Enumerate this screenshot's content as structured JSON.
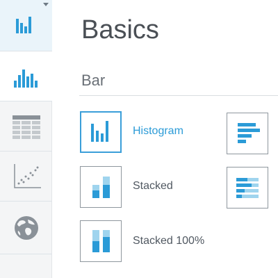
{
  "header": {
    "title": "Basics"
  },
  "section": {
    "title": "Bar"
  },
  "rail": {
    "top_icon": "bar-chart-icon",
    "items": [
      {
        "icon": "histogram-icon"
      },
      {
        "icon": "table-icon"
      },
      {
        "icon": "scatter-plot-icon"
      },
      {
        "icon": "globe-icon"
      }
    ]
  },
  "chart_types": [
    {
      "label": "Histogram",
      "icon": "histogram-icon",
      "selected": true
    },
    {
      "label": "",
      "icon": "horizontal-bar-icon"
    },
    {
      "label": "Stacked",
      "icon": "stacked-bar-icon"
    },
    {
      "label": "",
      "icon": "horizontal-stacked-bar-icon"
    },
    {
      "label": "Stacked 100%",
      "icon": "stacked-100-bar-icon"
    }
  ],
  "colors": {
    "accent": "#2b9bd7",
    "accent_light": "#9fd4ee",
    "rail_bg": "#f4f5f6",
    "icon_gray": "#8a9198"
  }
}
